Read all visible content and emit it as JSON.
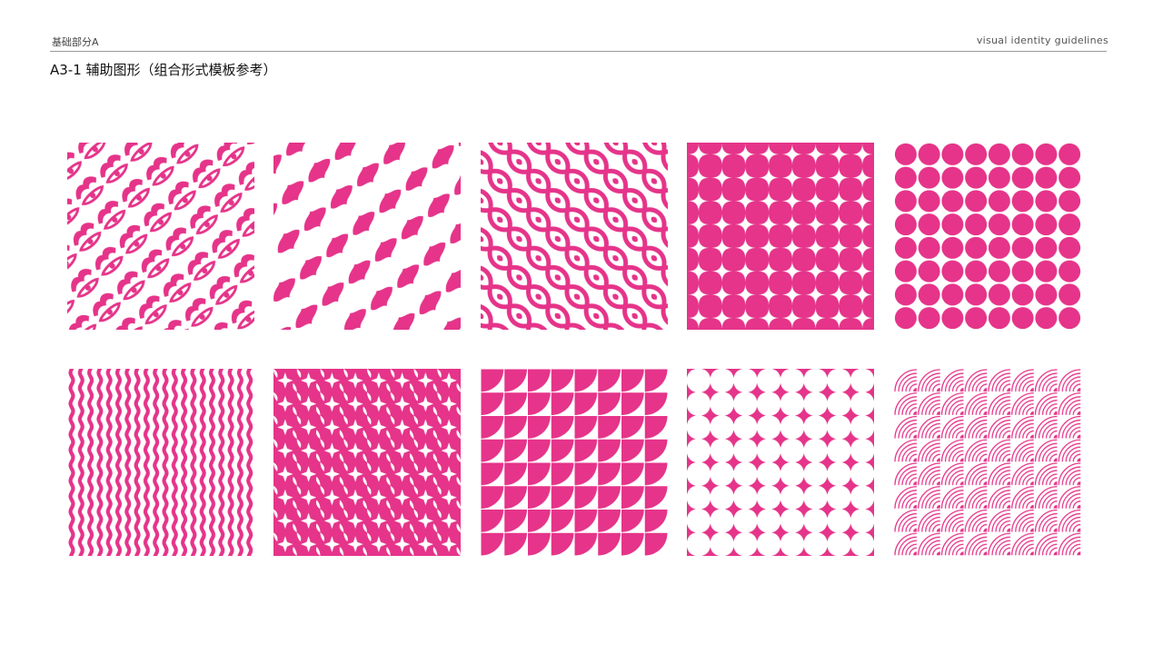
{
  "header": {
    "section": "基础部分A",
    "guide_name": "visual identity guidelines"
  },
  "title": "A3-1 辅助图形（组合形式模板参考）",
  "colors": {
    "accent": "#e5348a",
    "background": "#ffffff",
    "rule": "#9a9a9a"
  },
  "patterns": [
    {
      "id": "diagonal-emblem-pattern"
    },
    {
      "id": "diagonal-leaf-pattern"
    },
    {
      "id": "lattice-ribbon-pattern"
    },
    {
      "id": "four-point-star-lattice-pattern"
    },
    {
      "id": "circle-grid-pattern"
    },
    {
      "id": "wavy-stripe-pattern"
    },
    {
      "id": "pinwheel-star-pattern"
    },
    {
      "id": "quarter-circle-grid-pattern"
    },
    {
      "id": "concave-star-pattern"
    },
    {
      "id": "concentric-arc-pattern"
    }
  ]
}
